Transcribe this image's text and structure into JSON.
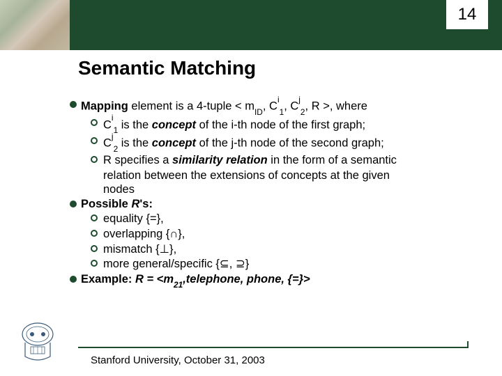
{
  "page_number": "14",
  "title": "Semantic Matching",
  "b1_lead": "Mapping",
  "b1_mid1": " element is a 4-tuple < m",
  "b1_sub1": "ID",
  "b1_mid2": ", C",
  "b1_sup1": "i",
  "b1_sub2": "1",
  "b1_mid3": ", C",
  "b1_sup2": "j",
  "b1_sub3": "2",
  "b1_mid4": ", R >, where",
  "b1a_pre": "C",
  "b1a_sup": "i",
  "b1a_sub": "1",
  "b1a_mid": " is the ",
  "b1a_concept": "concept",
  "b1a_post": " of the i-th node of the first graph;",
  "b1b_pre": "C",
  "b1b_sup": "j",
  "b1b_sub": "2",
  "b1b_mid": " is the ",
  "b1b_concept": "concept",
  "b1b_post": " of the j-th node of the second graph;",
  "b1c_pre": "R specifies a ",
  "b1c_emph": "similarity relation",
  "b1c_post1": " in the form of a semantic",
  "b1c_line2": "relation between the extensions of concepts at the given",
  "b1c_line3": "nodes",
  "b2_lead": "Possible ",
  "b2_r": "R",
  "b2_post": "'s:",
  "b2a": "equality {=},",
  "b2b": "overlapping {∩},",
  "b2c": "mismatch {⊥},",
  "b2d": "more general/specific {⊆, ⊇}",
  "b3_lead": "Example:",
  "b3_r": " R",
  "b3_mid": " = <m",
  "b3_sub": "21",
  "b3_post": ",telephone, phone, {=}>",
  "footer": "Stanford University, October 31, 2003"
}
